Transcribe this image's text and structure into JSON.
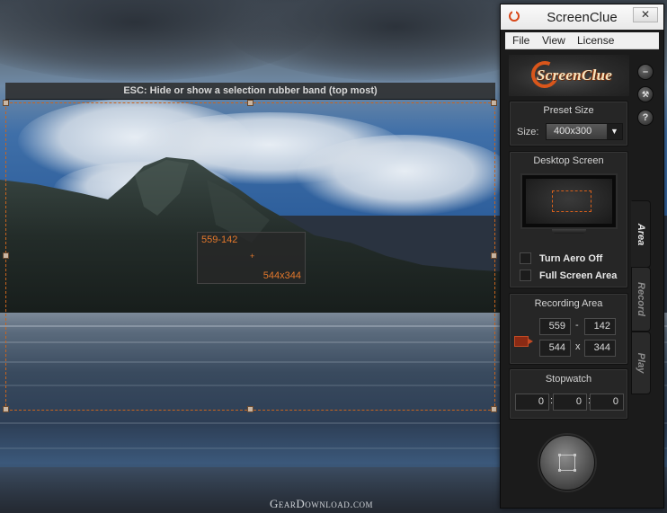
{
  "background": {
    "watermark": "GearDownload.com"
  },
  "selection": {
    "hint": "ESC: Hide or show a selection rubber band (top most)",
    "position_label": "559-142",
    "size_label": "544x344",
    "accent_color": "#d8601c"
  },
  "window": {
    "title": "ScreenClue",
    "close_glyph": "✕",
    "menu": [
      "File",
      "View",
      "License"
    ],
    "logo_text": "ScreenClue",
    "side_buttons": [
      {
        "name": "minimize-icon",
        "glyph": "–"
      },
      {
        "name": "wrench-icon",
        "glyph": "🔧"
      },
      {
        "name": "help-icon",
        "glyph": "?"
      }
    ],
    "preset": {
      "title": "Preset Size",
      "size_label": "Size:",
      "size_value": "400x300"
    },
    "desktop": {
      "title": "Desktop Screen",
      "aero_label": "Turn Aero Off",
      "fullscreen_label": "Full Screen Area"
    },
    "recording": {
      "title": "Recording Area",
      "x": "559",
      "y": "142",
      "w": "544",
      "h": "344",
      "dash": "-",
      "times": "x"
    },
    "stopwatch": {
      "title": "Stopwatch",
      "h": "0",
      "m": "0",
      "s": "0",
      "colon": ":"
    },
    "tabs": [
      "Area",
      "Record",
      "Play"
    ],
    "active_tab": "Area"
  }
}
